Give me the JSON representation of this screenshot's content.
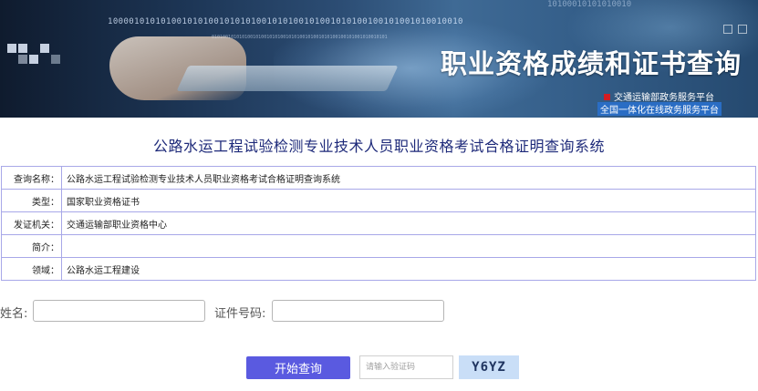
{
  "banner": {
    "title": "职业资格成绩和证书查询",
    "subtitle1": "交通运输部政务服务平台",
    "subtitle2": "全国一体化在线政务服务平台",
    "binary1": "1000010101010010101001010101001010100101001010100100101001010010010",
    "binary2": "0101001010101001010010101001010100101001010100100101001010010101",
    "binary3": "10100010101010010"
  },
  "page": {
    "title": "公路水运工程试验检测专业技术人员职业资格考试合格证明查询系统"
  },
  "info_rows": [
    {
      "label": "查询名称：",
      "value": "公路水运工程试验检测专业技术人员职业资格考试合格证明查询系统"
    },
    {
      "label": "类型：",
      "value": "国家职业资格证书"
    },
    {
      "label": "发证机关：",
      "value": "交通运输部职业资格中心"
    },
    {
      "label": "简介：",
      "value": ""
    },
    {
      "label": "领域：",
      "value": "公路水运工程建设"
    }
  ],
  "form": {
    "name_label": "姓名:",
    "name_value": "",
    "id_label": "证件号码:",
    "id_value": "",
    "query_button": "开始查询",
    "captcha_placeholder": "请输入验证码",
    "captcha_value": "",
    "captcha_code": "Y6YZ"
  },
  "colors": {
    "accent": "#5a5ae0",
    "title": "#1e2a7a",
    "table_border": "#a8a8e8",
    "captcha_bg": "#c9def7"
  }
}
